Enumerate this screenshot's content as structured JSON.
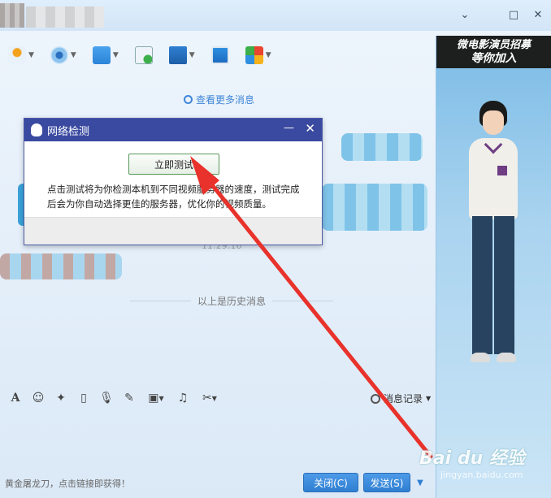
{
  "window": {
    "minimize": "⌄",
    "maximize": "□",
    "close": "✕"
  },
  "chat": {
    "more_messages": "查看更多消息",
    "time": "11:29:16",
    "history_divider": "以上是历史消息"
  },
  "ad": {
    "line1": "微电影演员招募",
    "line2": "等你加入"
  },
  "input_toolbar": {
    "message_record": "消息记录"
  },
  "bottom": {
    "promo": "黄金屠龙刀，点击链接即获得！",
    "close_button": "关闭(C)",
    "send_button": "发送(S)"
  },
  "dialog": {
    "title": "网络检测",
    "minimize": "—",
    "close": "✕",
    "test_button": "立即测试",
    "description": "点击测试将为你检测本机到不同视频服务器的速度，测试完成后会为你自动选择更佳的服务器，优化你的视频质量。"
  },
  "watermark": {
    "main": "Bai du 经验",
    "sub": "jingyan.baidu.com"
  },
  "colors": {
    "accent": "#3f86d8",
    "dialog_title": "#3a4aa0",
    "arrow": "#e8322b"
  }
}
